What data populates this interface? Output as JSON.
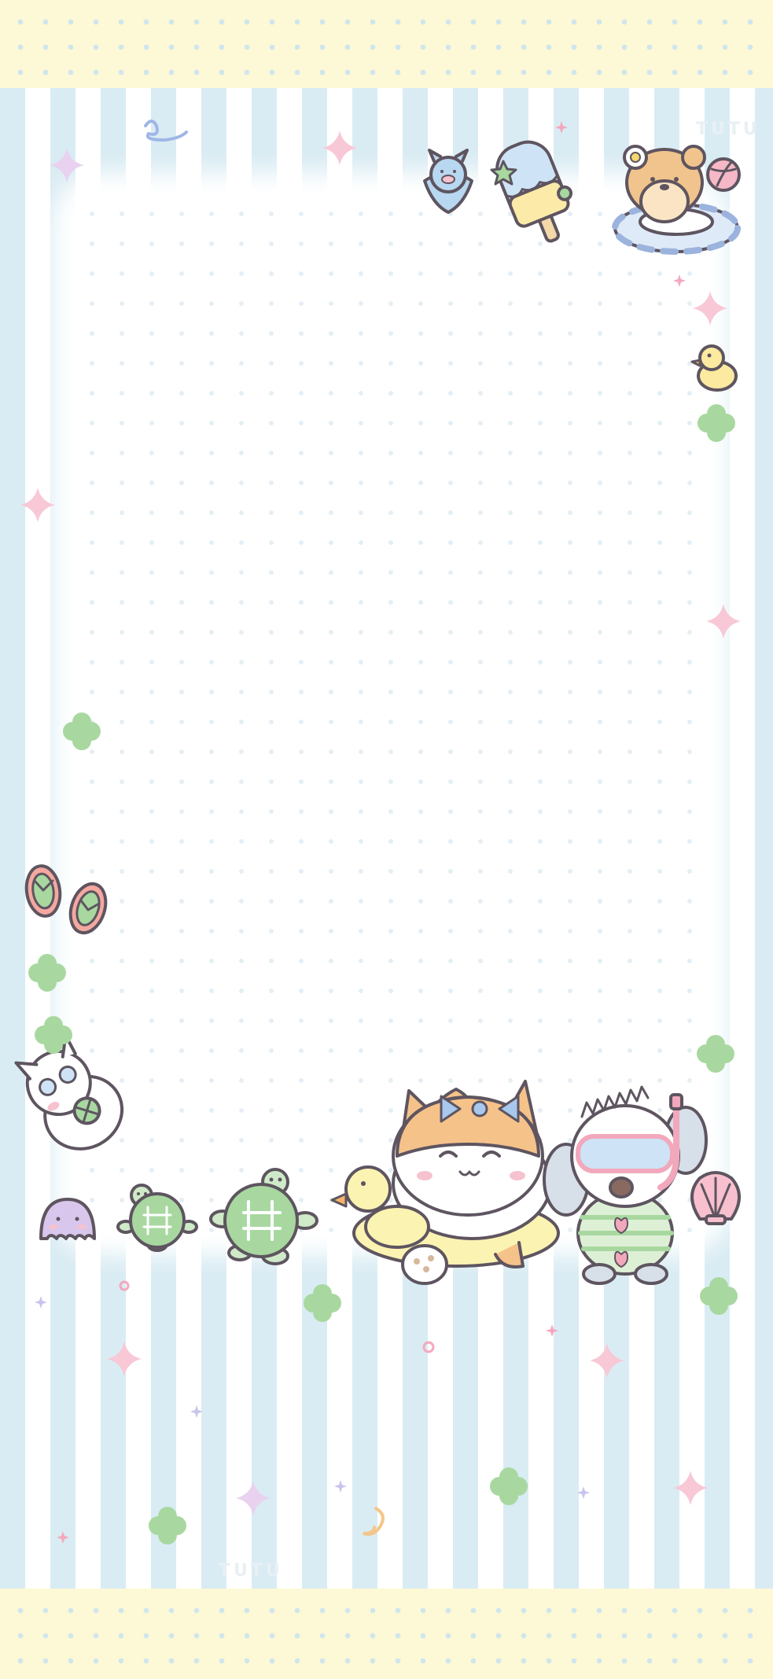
{
  "watermark_top": "TUTU",
  "watermark_bottom": "TUTU",
  "colors": {
    "band": "#fdf8d6",
    "stripe_blue": "#d9ecf3",
    "stripe_white": "#ffffff",
    "paper": "#ffffff",
    "outline": "#5e5560",
    "pink": "#f4b9c9",
    "green": "#a8d8a0",
    "lilac": "#d9c6ec"
  },
  "icons": [
    "bird-icon",
    "popsicle-icon",
    "bear-float-icon",
    "duck-icon",
    "sandals-icon",
    "sunglasses-cat-icon",
    "octopus-icon",
    "turtle-icon",
    "cat-duck-float-icon",
    "snorkel-dog-icon",
    "shell-icon",
    "clover-icon",
    "sparkle-icon"
  ]
}
